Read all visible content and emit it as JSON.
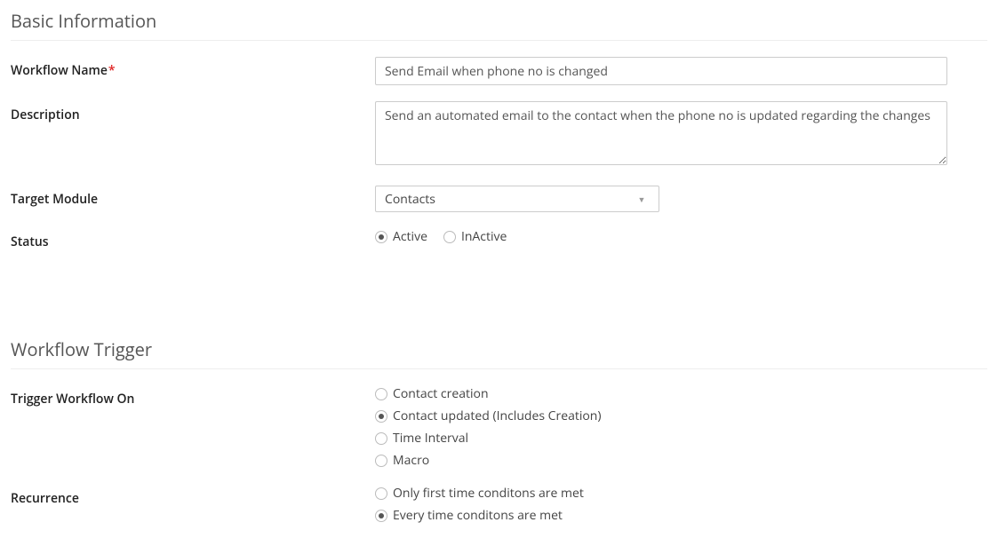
{
  "sections": {
    "basic": {
      "title": "Basic Information",
      "fields": {
        "workflowName": {
          "label": "Workflow Name",
          "value": "Send Email when phone no is changed",
          "required": "*"
        },
        "description": {
          "label": "Description",
          "value": "Send an automated email to the contact when the phone no is updated regarding the changes"
        },
        "targetModule": {
          "label": "Target Module",
          "value": "Contacts"
        },
        "status": {
          "label": "Status",
          "options": {
            "active": "Active",
            "inactive": "InActive"
          }
        }
      }
    },
    "trigger": {
      "title": "Workflow Trigger",
      "fields": {
        "triggerOn": {
          "label": "Trigger Workflow On",
          "options": {
            "creation": "Contact creation",
            "updated": "Contact updated  (Includes Creation)",
            "timeInterval": "Time Interval",
            "macro": " Macro"
          }
        },
        "recurrence": {
          "label": "Recurrence",
          "options": {
            "first": "Only first time conditons are met",
            "every": "Every time conditons are met"
          }
        }
      }
    }
  }
}
